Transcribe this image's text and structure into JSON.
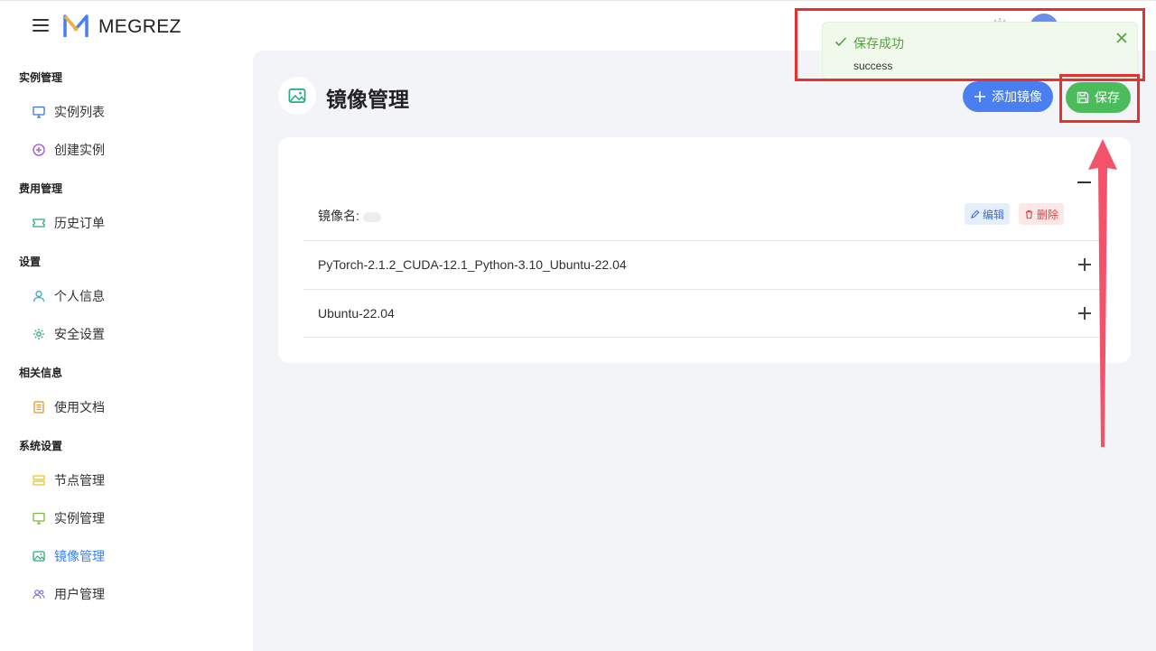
{
  "header": {
    "brand": "MEGREZ"
  },
  "sidebar": {
    "groups": [
      {
        "title": "实例管理",
        "items": [
          {
            "label": "实例列表",
            "icon": "monitor-icon"
          },
          {
            "label": "创建实例",
            "icon": "plus-circle-icon"
          }
        ]
      },
      {
        "title": "费用管理",
        "items": [
          {
            "label": "历史订单",
            "icon": "ticket-icon"
          }
        ]
      },
      {
        "title": "设置",
        "items": [
          {
            "label": "个人信息",
            "icon": "user-icon"
          },
          {
            "label": "安全设置",
            "icon": "gear-icon"
          }
        ]
      },
      {
        "title": "相关信息",
        "items": [
          {
            "label": "使用文档",
            "icon": "document-icon"
          }
        ]
      },
      {
        "title": "系统设置",
        "items": [
          {
            "label": "节点管理",
            "icon": "server-icon"
          },
          {
            "label": "实例管理",
            "icon": "monitor-icon"
          },
          {
            "label": "镜像管理",
            "icon": "image-icon",
            "active": true
          },
          {
            "label": "用户管理",
            "icon": "users-icon"
          }
        ]
      }
    ]
  },
  "page": {
    "title": "镜像管理",
    "add_button": "添加镜像",
    "save_button": "保存"
  },
  "images": {
    "name_label": "镜像名:",
    "edit_label": "编辑",
    "delete_label": "删除",
    "rows": [
      {
        "name": "PyTorch-2.1.2_CUDA-12.1_Python-3.10_Ubuntu-22.04"
      },
      {
        "name": "Ubuntu-22.04"
      }
    ]
  },
  "toast": {
    "title": "保存成功",
    "message": "success"
  },
  "colors": {
    "primary": "#4a7ff2",
    "success": "#4cbb5c",
    "annotation": "#e6312f"
  }
}
